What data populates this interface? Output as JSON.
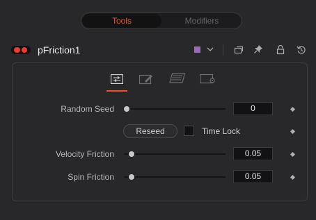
{
  "tabs": {
    "tools_label": "Tools",
    "modifiers_label": "Modifiers",
    "active": "Tools"
  },
  "header": {
    "tool_name": "pFriction1",
    "toggle_on": true,
    "swatch_color": "#9a6cb8",
    "icons": [
      "color-dropdown-chevron-icon",
      "version-icon",
      "pin-icon",
      "lock-icon",
      "reset-icon"
    ]
  },
  "panel_tabs": [
    {
      "name": "controls",
      "icon": "sliders-icon",
      "active": true
    },
    {
      "name": "style",
      "icon": "edit-icon",
      "active": false
    },
    {
      "name": "region",
      "icon": "region-icon",
      "active": false
    },
    {
      "name": "settings",
      "icon": "settings-icon",
      "active": false
    }
  ],
  "controls": {
    "random_seed": {
      "label": "Random Seed",
      "value": "0",
      "fraction": 0.0
    },
    "reseed_label": "Reseed",
    "time_lock": {
      "label": "Time Lock",
      "checked": false
    },
    "velocity_friction": {
      "label": "Velocity Friction",
      "value": "0.05",
      "fraction": 0.05
    },
    "spin_friction": {
      "label": "Spin Friction",
      "value": "0.05",
      "fraction": 0.05
    }
  },
  "colors": {
    "accent": "#e9542f",
    "toggle": "#ee3b2b",
    "background": "#28282b"
  }
}
